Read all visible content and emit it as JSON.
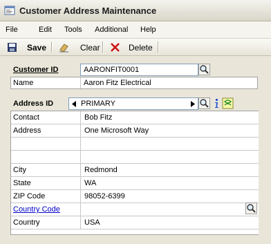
{
  "window": {
    "title": "Customer Address Maintenance"
  },
  "menu": [
    "File",
    "Edit",
    "Tools",
    "Additional",
    "Help"
  ],
  "toolbar": {
    "save_label": "Save",
    "clear_label": "Clear",
    "delete_label": "Delete"
  },
  "customer": {
    "id_label": "Customer ID",
    "id_value": "AARONFIT0001",
    "name_label": "Name",
    "name_value": "Aaron Fitz Electrical"
  },
  "address": {
    "id_label": "Address ID",
    "id_value": "PRIMARY",
    "contact_label": "Contact",
    "contact_value": "Bob Fitz",
    "address_label": "Address",
    "address_line1": "One Microsoft Way",
    "address_line2": "",
    "address_line3": "",
    "city_label": "City",
    "city_value": "Redmond",
    "state_label": "State",
    "state_value": "WA",
    "zip_label": "ZIP Code",
    "zip_value": "98052-6399",
    "country_code_label": "Country Code",
    "country_code_value": "",
    "country_label": "Country",
    "country_value": "USA"
  },
  "icons": {
    "app": "app-window-icon",
    "save": "floppy-disk-icon",
    "clear": "eraser-icon",
    "delete": "red-x-icon",
    "lookup": "magnifier-icon",
    "info": "info-i-icon",
    "notes": "note-icon"
  },
  "colors": {
    "link": "#0000cc",
    "delete_icon": "#cc1111",
    "info_icon": "#1b4fd1"
  }
}
